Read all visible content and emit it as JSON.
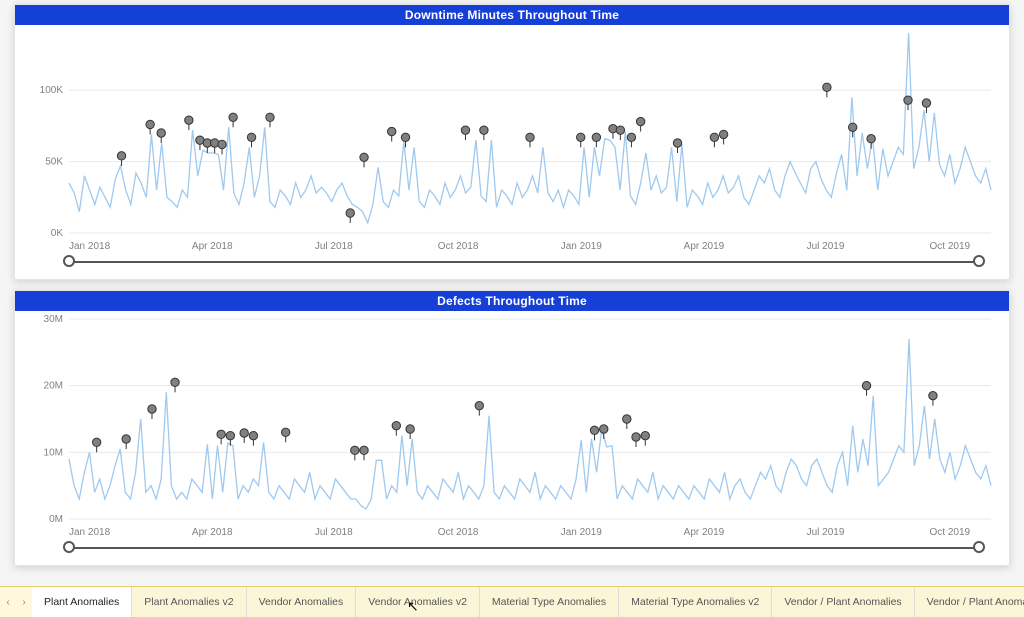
{
  "chart_data": [
    {
      "type": "line",
      "title": "Downtime Minutes Throughout Time",
      "xlabel": "",
      "ylabel": "",
      "ylim": [
        0,
        140000
      ],
      "y_ticks": [
        0,
        50000,
        100000
      ],
      "y_tick_labels": [
        "0K",
        "50K",
        "100K"
      ],
      "x_tick_labels": [
        "Jan 2018",
        "Apr 2018",
        "Jul 2018",
        "Oct 2018",
        "Jan 2019",
        "Apr 2019",
        "Jul 2019",
        "Oct 2019"
      ],
      "anomaly_points": [
        {
          "x": 0.057,
          "y": 47000
        },
        {
          "x": 0.088,
          "y": 69000
        },
        {
          "x": 0.1,
          "y": 63000
        },
        {
          "x": 0.13,
          "y": 72000
        },
        {
          "x": 0.142,
          "y": 58000
        },
        {
          "x": 0.15,
          "y": 56000
        },
        {
          "x": 0.158,
          "y": 56000
        },
        {
          "x": 0.166,
          "y": 55000
        },
        {
          "x": 0.178,
          "y": 74000
        },
        {
          "x": 0.198,
          "y": 60000
        },
        {
          "x": 0.218,
          "y": 74000
        },
        {
          "x": 0.305,
          "y": 7000
        },
        {
          "x": 0.32,
          "y": 46000
        },
        {
          "x": 0.35,
          "y": 64000
        },
        {
          "x": 0.365,
          "y": 60000
        },
        {
          "x": 0.43,
          "y": 65000
        },
        {
          "x": 0.45,
          "y": 65000
        },
        {
          "x": 0.5,
          "y": 60000
        },
        {
          "x": 0.555,
          "y": 60000
        },
        {
          "x": 0.572,
          "y": 60000
        },
        {
          "x": 0.59,
          "y": 66000
        },
        {
          "x": 0.598,
          "y": 65000
        },
        {
          "x": 0.61,
          "y": 60000
        },
        {
          "x": 0.62,
          "y": 71000
        },
        {
          "x": 0.66,
          "y": 56000
        },
        {
          "x": 0.7,
          "y": 60000
        },
        {
          "x": 0.71,
          "y": 62000
        },
        {
          "x": 0.822,
          "y": 95000
        },
        {
          "x": 0.85,
          "y": 67000
        },
        {
          "x": 0.87,
          "y": 59000
        },
        {
          "x": 0.91,
          "y": 86000
        },
        {
          "x": 0.93,
          "y": 84000
        }
      ],
      "series": [
        {
          "name": "Downtime Minutes",
          "max_value": 140000,
          "values": [
            35000,
            28000,
            15000,
            40000,
            30000,
            20000,
            32000,
            25000,
            18000,
            38000,
            47000,
            30000,
            20000,
            42000,
            35000,
            25000,
            69000,
            30000,
            63000,
            25000,
            22000,
            18000,
            30000,
            25000,
            72000,
            40000,
            58000,
            56000,
            56000,
            55000,
            30000,
            74000,
            28000,
            20000,
            35000,
            60000,
            25000,
            40000,
            74000,
            22000,
            18000,
            30000,
            26000,
            20000,
            35000,
            25000,
            30000,
            40000,
            28000,
            32000,
            28000,
            22000,
            30000,
            35000,
            26000,
            20000,
            18000,
            15000,
            7000,
            20000,
            46000,
            22000,
            18000,
            30000,
            26000,
            64000,
            30000,
            60000,
            22000,
            18000,
            30000,
            26000,
            20000,
            35000,
            25000,
            30000,
            40000,
            28000,
            32000,
            65000,
            26000,
            22000,
            65000,
            18000,
            30000,
            26000,
            20000,
            35000,
            25000,
            30000,
            40000,
            28000,
            60000,
            28000,
            22000,
            30000,
            18000,
            30000,
            26000,
            20000,
            60000,
            25000,
            60000,
            40000,
            66000,
            65000,
            60000,
            30000,
            71000,
            26000,
            20000,
            35000,
            56000,
            30000,
            40000,
            28000,
            32000,
            60000,
            22000,
            62000,
            18000,
            30000,
            26000,
            20000,
            35000,
            25000,
            30000,
            40000,
            28000,
            32000,
            40000,
            25000,
            20000,
            30000,
            40000,
            35000,
            45000,
            30000,
            25000,
            40000,
            50000,
            42000,
            35000,
            28000,
            45000,
            50000,
            38000,
            30000,
            25000,
            42000,
            55000,
            30000,
            95000,
            40000,
            70000,
            45000,
            67000,
            30000,
            59000,
            40000,
            50000,
            60000,
            55000,
            140000,
            45000,
            60000,
            86000,
            50000,
            84000,
            48000,
            40000,
            55000,
            35000,
            45000,
            60000,
            50000,
            40000,
            35000,
            45000,
            30000
          ]
        }
      ]
    },
    {
      "type": "line",
      "title": "Defects Throughout Time",
      "xlabel": "",
      "ylabel": "",
      "ylim": [
        0,
        30000000
      ],
      "y_ticks": [
        0,
        10000000,
        20000000,
        30000000
      ],
      "y_tick_labels": [
        "0M",
        "10M",
        "20M",
        "30M"
      ],
      "x_tick_labels": [
        "Jan 2018",
        "Apr 2018",
        "Jul 2018",
        "Oct 2018",
        "Jan 2019",
        "Apr 2019",
        "Jul 2019",
        "Oct 2019"
      ],
      "anomaly_points": [
        {
          "x": 0.03,
          "y": 10000000
        },
        {
          "x": 0.062,
          "y": 10500000
        },
        {
          "x": 0.09,
          "y": 15000000
        },
        {
          "x": 0.115,
          "y": 19000000
        },
        {
          "x": 0.165,
          "y": 11200000
        },
        {
          "x": 0.175,
          "y": 11000000
        },
        {
          "x": 0.19,
          "y": 11400000
        },
        {
          "x": 0.2,
          "y": 11000000
        },
        {
          "x": 0.235,
          "y": 11500000
        },
        {
          "x": 0.31,
          "y": 8800000
        },
        {
          "x": 0.32,
          "y": 8800000
        },
        {
          "x": 0.355,
          "y": 12500000
        },
        {
          "x": 0.37,
          "y": 12000000
        },
        {
          "x": 0.445,
          "y": 15500000
        },
        {
          "x": 0.57,
          "y": 11800000
        },
        {
          "x": 0.58,
          "y": 12000000
        },
        {
          "x": 0.605,
          "y": 13500000
        },
        {
          "x": 0.615,
          "y": 10800000
        },
        {
          "x": 0.625,
          "y": 11000000
        },
        {
          "x": 0.865,
          "y": 18500000
        },
        {
          "x": 0.937,
          "y": 17000000
        }
      ],
      "series": [
        {
          "name": "Defects",
          "max_value": 30000000,
          "values": [
            9000000,
            5000000,
            3000000,
            7000000,
            10000000,
            4000000,
            6000000,
            3000000,
            5000000,
            8000000,
            10500000,
            4000000,
            3000000,
            7000000,
            15000000,
            4000000,
            5000000,
            3000000,
            6000000,
            19000000,
            5000000,
            3000000,
            4000000,
            3000000,
            6000000,
            5000000,
            4000000,
            11200000,
            3000000,
            11000000,
            4000000,
            11400000,
            11000000,
            3000000,
            5000000,
            4000000,
            6000000,
            5000000,
            11500000,
            4000000,
            3000000,
            5000000,
            4000000,
            3000000,
            6000000,
            5000000,
            4000000,
            7000000,
            3000000,
            5000000,
            4000000,
            3000000,
            6000000,
            5000000,
            4000000,
            3000000,
            3000000,
            2000000,
            1500000,
            3000000,
            8800000,
            8800000,
            3000000,
            5000000,
            4000000,
            12500000,
            5000000,
            12000000,
            4000000,
            3000000,
            5000000,
            4000000,
            3000000,
            6000000,
            5000000,
            4000000,
            7000000,
            3000000,
            5000000,
            4000000,
            3000000,
            5000000,
            15500000,
            4000000,
            3000000,
            5000000,
            4000000,
            3000000,
            6000000,
            5000000,
            4000000,
            7000000,
            3000000,
            5000000,
            4000000,
            3000000,
            5000000,
            4000000,
            3000000,
            6000000,
            11800000,
            4000000,
            12000000,
            7000000,
            13500000,
            10800000,
            11000000,
            3000000,
            5000000,
            4000000,
            3000000,
            6000000,
            5000000,
            4000000,
            7000000,
            3000000,
            5000000,
            4000000,
            3000000,
            5000000,
            4000000,
            3000000,
            5000000,
            4000000,
            3000000,
            6000000,
            5000000,
            4000000,
            7000000,
            3000000,
            5000000,
            6000000,
            4000000,
            3000000,
            5000000,
            7000000,
            6000000,
            8000000,
            5000000,
            4000000,
            7000000,
            9000000,
            8000000,
            6000000,
            5000000,
            8000000,
            9000000,
            7000000,
            5000000,
            4000000,
            8000000,
            10000000,
            5000000,
            14000000,
            7000000,
            12000000,
            8000000,
            18500000,
            5000000,
            6000000,
            7000000,
            9000000,
            11000000,
            10000000,
            27000000,
            8000000,
            11000000,
            17000000,
            9000000,
            15000000,
            9000000,
            7000000,
            10000000,
            6000000,
            8000000,
            11000000,
            9000000,
            7000000,
            6000000,
            8000000,
            5000000
          ]
        }
      ]
    }
  ],
  "tabs": {
    "prev_icon": "‹",
    "next_icon": "›",
    "active_index": 0,
    "items": [
      "Plant Anomalies",
      "Plant Anomalies v2",
      "Vendor Anomalies",
      "Vendor Anomalies v2",
      "Material Type Anomalies",
      "Material Type Anomalies v2",
      "Vendor / Plant Anomalies",
      "Vendor / Plant Anomalies v2",
      "Vendor / Plant Ano"
    ]
  },
  "colors": {
    "title_bar": "#153fd6",
    "line": "#9fc9ef",
    "anomaly_fill": "#808080",
    "anomaly_stroke": "#333333"
  }
}
